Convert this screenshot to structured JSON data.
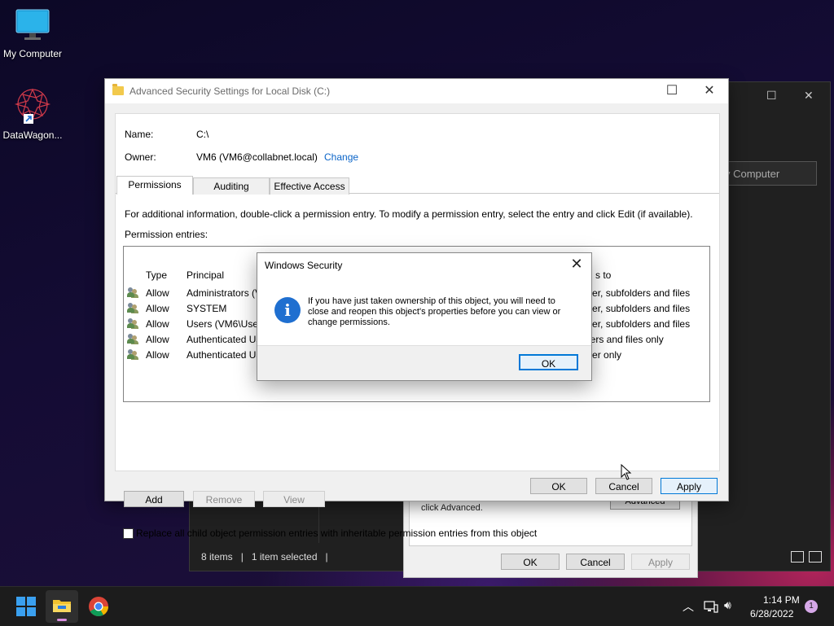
{
  "desktop": {
    "icons": [
      {
        "label": "My Computer",
        "icon": "monitor-icon"
      },
      {
        "label": "DataWagon...",
        "icon": "datawagon-icon"
      }
    ]
  },
  "background_explorer": {
    "address_text": "y Computer",
    "status": {
      "items": "8 items",
      "selected": "1 item selected"
    }
  },
  "properties_dialog": {
    "text": "click Advanced.",
    "advanced_button": "Advanced",
    "ok": "OK",
    "cancel": "Cancel",
    "apply": "Apply"
  },
  "advanced_security": {
    "title": "Advanced Security Settings for Local Disk (C:)",
    "name_label": "Name:",
    "name_value": "C:\\",
    "owner_label": "Owner:",
    "owner_value": "VM6 (VM6@collabnet.local)",
    "owner_change": "Change",
    "tabs": [
      "Permissions",
      "Auditing",
      "Effective Access"
    ],
    "info_text": "For additional information, double-click a permission entry. To modify a permission entry, select the entry and click Edit (if available).",
    "entries_label": "Permission entries:",
    "columns": {
      "type": "Type",
      "principal": "Principal",
      "applies_to": "s to"
    },
    "rows": [
      {
        "type": "Allow",
        "principal": "Administrators (V",
        "applies": "older, subfolders and files"
      },
      {
        "type": "Allow",
        "principal": "SYSTEM",
        "applies": "older, subfolders and files"
      },
      {
        "type": "Allow",
        "principal": "Users (VM6\\User",
        "applies": "older, subfolders and files"
      },
      {
        "type": "Allow",
        "principal": "Authenticated Us",
        "applies": "ders and files only"
      },
      {
        "type": "Allow",
        "principal": "Authenticated Us",
        "applies": "older only"
      }
    ],
    "buttons": {
      "add": "Add",
      "remove": "Remove",
      "view": "View"
    },
    "replace_checkbox": "Replace all child object permission entries with inheritable permission entries from this object",
    "footer": {
      "ok": "OK",
      "cancel": "Cancel",
      "apply": "Apply"
    }
  },
  "modal": {
    "title": "Windows Security",
    "message": "If you have just taken ownership of this object, you will need to close and reopen this object's properties before you can view or change permissions.",
    "ok": "OK"
  },
  "taskbar": {
    "time": "1:14 PM",
    "date": "6/28/2022",
    "notification_count": "1"
  },
  "colors": {
    "accent": "#0078d7",
    "link": "#0a64c8",
    "info": "#1f6fd0"
  }
}
